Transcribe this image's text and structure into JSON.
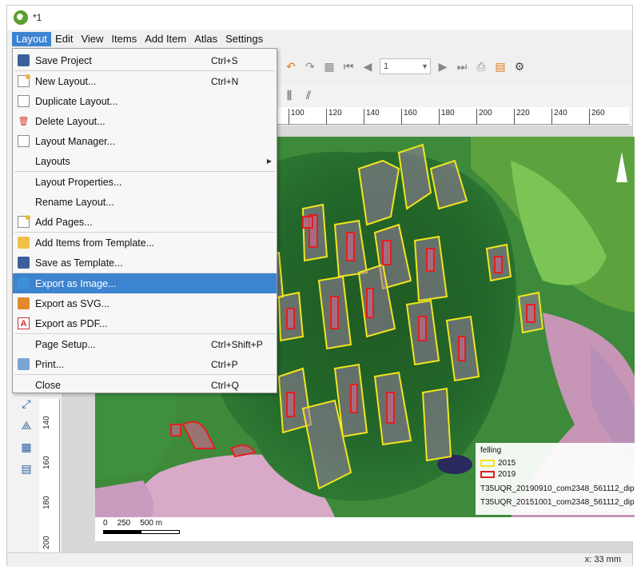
{
  "window": {
    "title": "*1"
  },
  "menubar": {
    "items": [
      {
        "label": "Layout",
        "active": true
      },
      {
        "label": "Edit"
      },
      {
        "label": "View"
      },
      {
        "label": "Items"
      },
      {
        "label": "Add Item"
      },
      {
        "label": "Atlas"
      },
      {
        "label": "Settings"
      }
    ]
  },
  "layout_menu": {
    "items": [
      {
        "label": "Save Project",
        "shortcut": "Ctrl+S",
        "icon": "save-icon"
      },
      {
        "label": "New Layout...",
        "shortcut": "Ctrl+N",
        "icon": "new-layout-icon"
      },
      {
        "label": "Duplicate Layout...",
        "shortcut": "",
        "icon": "duplicate-layout-icon"
      },
      {
        "label": "Delete Layout...",
        "shortcut": "",
        "icon": "trash-icon"
      },
      {
        "label": "Layout Manager...",
        "shortcut": "",
        "icon": "layout-manager-icon"
      },
      {
        "label": "Layouts",
        "shortcut": "",
        "icon": "",
        "submenu": true
      },
      {
        "label": "Layout Properties...",
        "shortcut": "",
        "icon": ""
      },
      {
        "label": "Rename Layout...",
        "shortcut": "",
        "icon": ""
      },
      {
        "label": "Add Pages...",
        "shortcut": "",
        "icon": "add-pages-icon"
      },
      {
        "label": "Add Items from Template...",
        "shortcut": "",
        "icon": "folder-icon"
      },
      {
        "label": "Save as Template...",
        "shortcut": "",
        "icon": "save-template-icon"
      },
      {
        "label": "Export as Image...",
        "shortcut": "",
        "icon": "export-image-icon",
        "highlighted": true
      },
      {
        "label": "Export as SVG...",
        "shortcut": "",
        "icon": "export-svg-icon"
      },
      {
        "label": "Export as PDF...",
        "shortcut": "",
        "icon": "export-pdf-icon"
      },
      {
        "label": "Page Setup...",
        "shortcut": "Ctrl+Shift+P",
        "icon": ""
      },
      {
        "label": "Print...",
        "shortcut": "Ctrl+P",
        "icon": "print-icon"
      },
      {
        "label": "Close",
        "shortcut": "Ctrl+Q",
        "icon": ""
      }
    ]
  },
  "toolbar": {
    "page_value": "1"
  },
  "ruler": {
    "top_ticks": [
      "100",
      "120",
      "140",
      "160",
      "180",
      "200",
      "220",
      "240",
      "260"
    ],
    "left_ticks": [
      "140",
      "160",
      "180",
      "200"
    ]
  },
  "scalebar": {
    "labels": [
      "0",
      "250",
      "500 m"
    ]
  },
  "legend": {
    "title": "felling",
    "entries": [
      {
        "label": "2015",
        "color": "#f2e51d"
      },
      {
        "label": "2019",
        "color": "#e02020"
      }
    ],
    "layers": [
      "T35UQR_20190910_com2348_561112_dip",
      "T35UQR_20151001_com2348_561112_dip"
    ]
  },
  "status": {
    "coordinate": "x: 33 mm"
  },
  "colors": {
    "accent": "#3c83d0",
    "felling_2015": "#f2e51d",
    "felling_2019": "#e02020"
  }
}
